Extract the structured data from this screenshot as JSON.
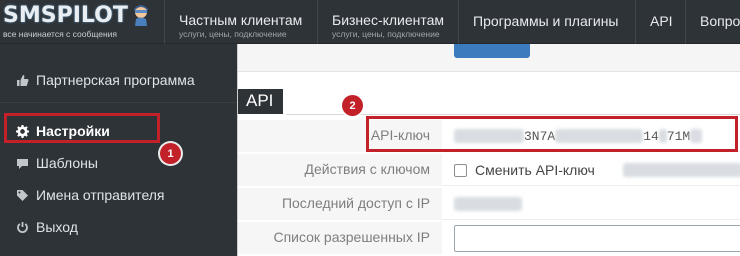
{
  "logo": {
    "brand": "SMSPILOT",
    "tagline": "все начинается с сообщения"
  },
  "nav": {
    "items": [
      {
        "label": "Частным клиентам",
        "sub": "услуги, цены, подключение"
      },
      {
        "label": "Бизнес-клиентам",
        "sub": "услуги, цены, подключение"
      },
      {
        "label": "Программы и плагины",
        "sub": ""
      },
      {
        "label": "API",
        "sub": ""
      },
      {
        "label": "Вопро",
        "sub": ""
      }
    ]
  },
  "sidebar": {
    "items": [
      {
        "label": "Партнерская программа",
        "icon": "thumbs-up-icon",
        "active": false
      },
      {
        "label": "Настройки",
        "icon": "gear-icon",
        "active": true
      },
      {
        "label": "Шаблоны",
        "icon": "comment-icon",
        "active": false
      },
      {
        "label": "Имена отправителя",
        "icon": "tag-icon",
        "active": false
      },
      {
        "label": "Выход",
        "icon": "power-icon",
        "active": false
      }
    ]
  },
  "section": {
    "title": "API"
  },
  "form": {
    "api_key_label": "API-ключ",
    "api_key_visible_1": "3N7A",
    "api_key_visible_2": "14",
    "api_key_visible_3": "71M",
    "actions_label": "Действия с ключом",
    "change_key_label": "Сменить API-ключ",
    "last_access_label": "Последний доступ с IP",
    "allowed_ips_label": "Список разрешенных IP",
    "allowed_ips_value": ""
  },
  "annotations": {
    "badge_1": "1",
    "badge_2": "2"
  },
  "colors": {
    "sidebar_bg": "#2e3338",
    "highlight_red": "#c2212a",
    "button_blue": "#3d7bbf"
  }
}
